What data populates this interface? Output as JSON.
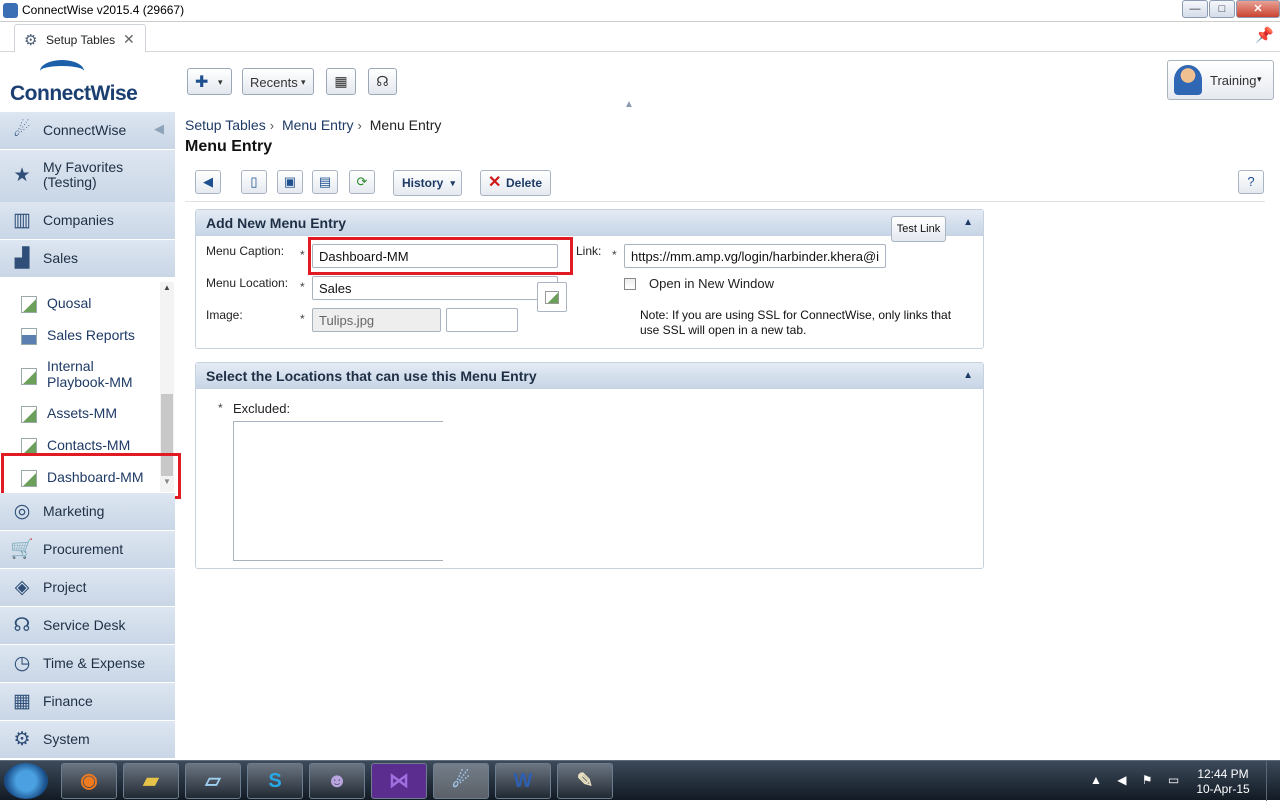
{
  "window": {
    "title": "ConnectWise v2015.4 (29667)",
    "min": "—",
    "max": "□",
    "close": "✕"
  },
  "tabs": [
    {
      "label": "Setup Tables",
      "close": "✕"
    }
  ],
  "header": {
    "logo_text": "ConnectWise",
    "add_label": "✚",
    "recents_label": "Recents",
    "user_label": "Training",
    "caret": "▾"
  },
  "sidebar": {
    "items": [
      {
        "label": "ConnectWise",
        "icon": "connectwise-icon"
      },
      {
        "label": "My Favorites (Testing)",
        "icon": "star-icon"
      },
      {
        "label": "Companies",
        "icon": "buildings-icon"
      },
      {
        "label": "Sales",
        "icon": "chart-icon"
      },
      {
        "label": "Marketing",
        "icon": "target-icon"
      },
      {
        "label": "Procurement",
        "icon": "cart-icon"
      },
      {
        "label": "Project",
        "icon": "cubes-icon"
      },
      {
        "label": "Service Desk",
        "icon": "headset-icon"
      },
      {
        "label": "Time & Expense",
        "icon": "clock-icon"
      },
      {
        "label": "Finance",
        "icon": "calculator-icon"
      },
      {
        "label": "System",
        "icon": "gears-icon"
      }
    ],
    "sales_sub": [
      {
        "label": "Quosal"
      },
      {
        "label": "Sales Reports"
      },
      {
        "label": "Internal Playbook-MM"
      },
      {
        "label": "Assets-MM"
      },
      {
        "label": "Contacts-MM"
      },
      {
        "label": "Dashboard-MM"
      }
    ]
  },
  "breadcrumb": [
    "Setup Tables",
    "Menu Entry",
    "Menu Entry"
  ],
  "breadcrumb_sep": "›",
  "page_title": "Menu Entry",
  "toolbar": {
    "history_label": "History",
    "delete_label": "Delete"
  },
  "form": {
    "panel_title": "Add New Menu Entry",
    "caption_label": "Menu Caption:",
    "caption_value": "Dashboard-MM",
    "location_label": "Menu Location:",
    "location_value": "Sales",
    "image_label": "Image:",
    "image_value": "Tulips.jpg",
    "link_label": "Link:",
    "link_value": "https://mm.amp.vg/login/harbinder.khera@i",
    "test_link_label": "Test Link",
    "new_window_label": "Open in New Window",
    "new_window_checked": false,
    "note": "Note: If you are using SSL for ConnectWise, only links that use SSL will open in a new tab.",
    "required_mark": "*"
  },
  "locations": {
    "panel_title": "Select the Locations that can use this Menu Entry",
    "excluded_label": "Excluded:"
  },
  "taskbar": {
    "apps": [
      "firefox-icon",
      "explorer-icon",
      "notepad-icon",
      "skype-icon",
      "github-icon",
      "visualstudio-icon",
      "connectwise-icon",
      "word-icon",
      "paint-icon"
    ],
    "time": "12:44 PM",
    "date": "10-Apr-15"
  }
}
